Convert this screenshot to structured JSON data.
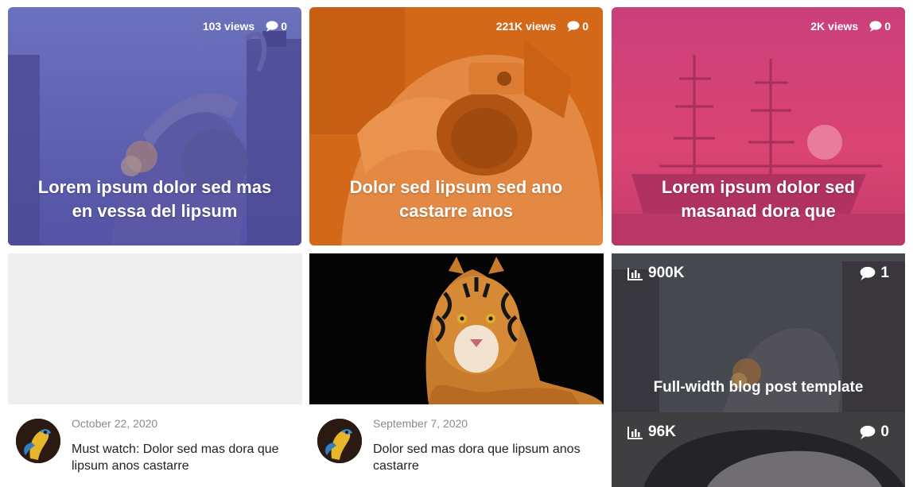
{
  "top_cards": [
    {
      "views": "103 views",
      "comments": "0",
      "title": "Lorem ipsum dolor sed mas en vessa del lipsum",
      "overlay_color": "#5a58b0"
    },
    {
      "views": "221K views",
      "comments": "0",
      "title": "Dolor sed lipsum sed ano castarre anos",
      "overlay_color": "#e06d18"
    },
    {
      "views": "2K views",
      "comments": "0",
      "title": "Lorem ipsum dolor sed masanad dora que",
      "overlay_color": "#d93a73"
    }
  ],
  "grid_posts": [
    {
      "date": "October 22, 2020",
      "title": "Must watch: Dolor sed mas dora que lipsum anos castarre"
    },
    {
      "date": "September 7, 2020",
      "title": "Dolor sed mas dora que lipsum anos castarre"
    }
  ],
  "right_posts": [
    {
      "views": "900K",
      "comments": "1",
      "title": "Full-width blog post template"
    },
    {
      "views": "96K",
      "comments": "0",
      "title": ""
    }
  ],
  "icons": {
    "comment": "comment-bubble-icon",
    "stats": "bar-chart-icon"
  }
}
